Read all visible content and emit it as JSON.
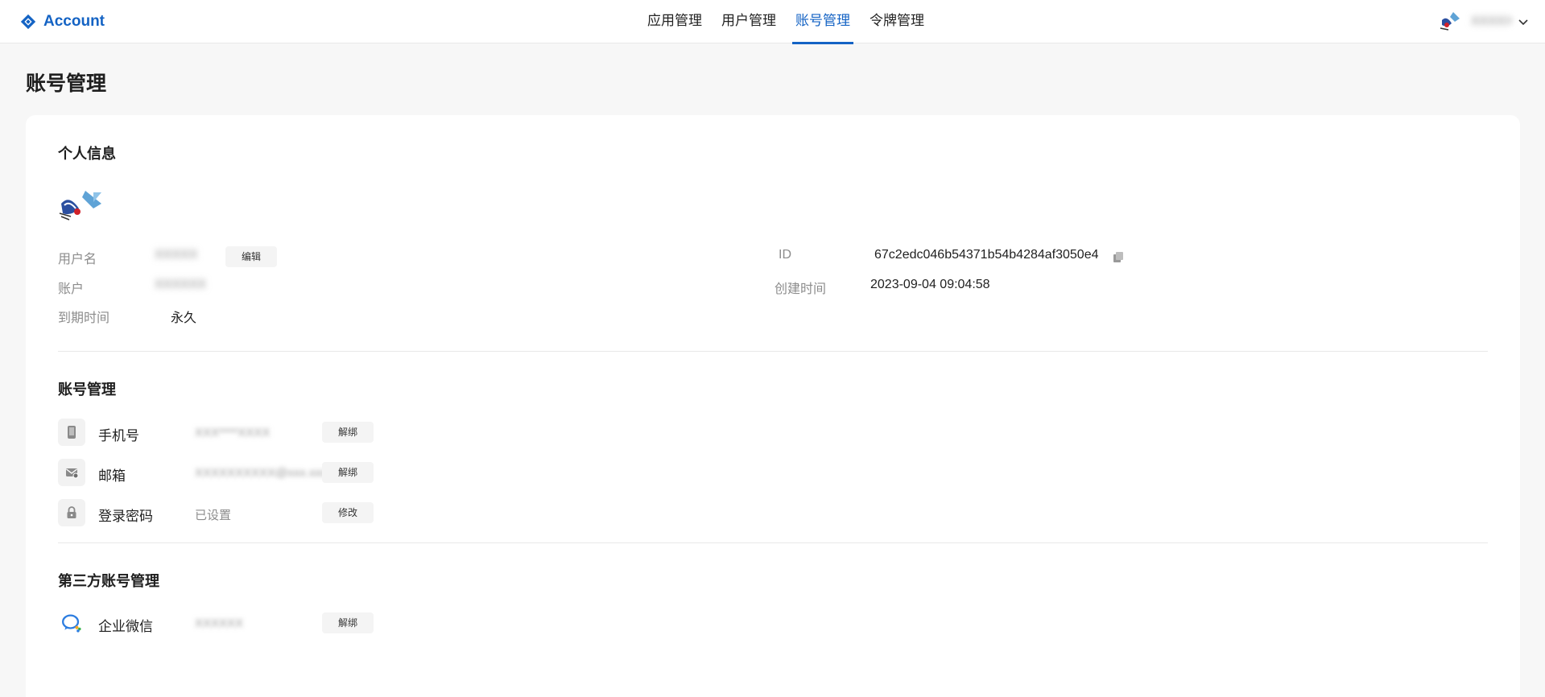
{
  "header": {
    "brand": "Account",
    "nav": [
      "应用管理",
      "用户管理",
      "账号管理",
      "令牌管理"
    ],
    "active_nav": "账号管理",
    "user_name": "XXXXX"
  },
  "page": {
    "title": "账号管理"
  },
  "personal": {
    "title": "个人信息",
    "username_label": "用户名",
    "username_value": "XXXXX",
    "edit_label": "编辑",
    "account_label": "账户",
    "account_value": "XXXXXX",
    "expire_label": "到期时间",
    "expire_value": "永久",
    "id_label": "ID",
    "id_value": "67c2edc046b54371b54b4284af3050e4",
    "created_label": "创建时间",
    "created_value": "2023-09-04 09:04:58"
  },
  "account_mgmt": {
    "title": "账号管理",
    "items": [
      {
        "name": "手机号",
        "value": "XXX****XXXX",
        "action": "解绑",
        "icon": "phone-icon"
      },
      {
        "name": "邮箱",
        "value": "XXXXXXXXXX@xxx.xxx",
        "action": "解绑",
        "icon": "mail-icon"
      },
      {
        "name": "登录密码",
        "value": "已设置",
        "action": "修改",
        "icon": "lock-icon"
      }
    ]
  },
  "third_party": {
    "title": "第三方账号管理",
    "items": [
      {
        "name": "企业微信",
        "value": "XXXXXX",
        "action": "解绑",
        "icon": "wecom-icon"
      }
    ]
  },
  "colors": {
    "accent": "#1463c4",
    "background": "#f7f7f7",
    "card": "#ffffff",
    "muted_text": "#8c8c8c"
  }
}
